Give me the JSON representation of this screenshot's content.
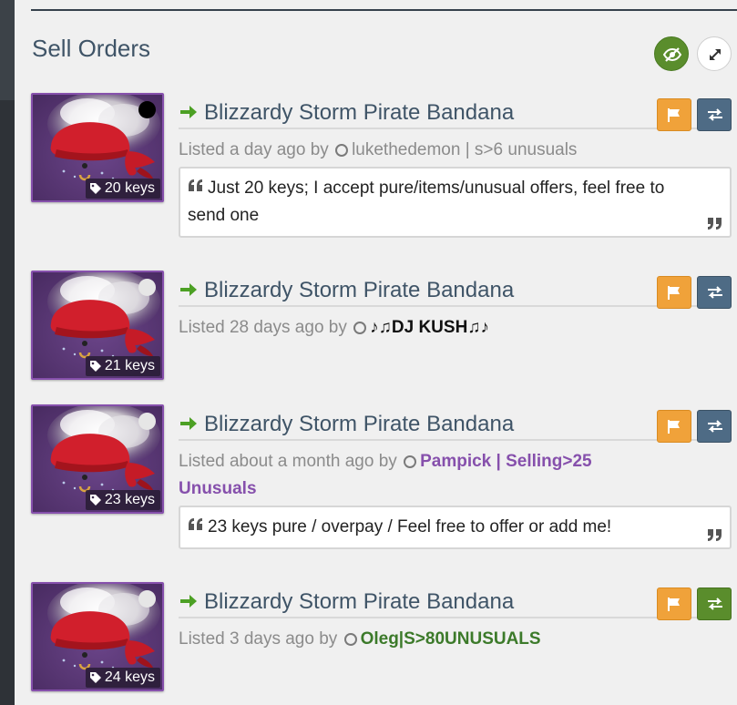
{
  "section": {
    "title": "Sell Orders",
    "eye_icon": "eye-slash-icon",
    "expand_icon": "expand-arrows-icon"
  },
  "colors": {
    "trade_blue": "#4e6b85",
    "trade_green": "#5a8d2c",
    "flag_orange": "#f0a23a",
    "unusual_purple": "#8650ac"
  },
  "listings": [
    {
      "item_name": "Blizzardy Storm Pirate Bandana",
      "price": "20 keys",
      "listed_prefix": "Listed a day ago by",
      "user": "lukethedemon | s>6 unusuals",
      "comment": "Just 20 keys; I accept pure/items/unusual offers, feel free to send one",
      "status_dot": "#000000"
    },
    {
      "item_name": "Blizzardy Storm Pirate Bandana",
      "price": "21 keys",
      "listed_prefix": "Listed 28 days ago by",
      "user": "♪♫DJ KUSH♫♪",
      "comment": "",
      "status_dot": "#e6e6e6"
    },
    {
      "item_name": "Blizzardy Storm Pirate Bandana",
      "price": "23 keys",
      "listed_prefix": "Listed about a month ago by",
      "user": "Pampick | Selling>25 Unusuals",
      "comment": "23 keys pure / overpay / Feel free to offer or add me!",
      "status_dot": "#e6e6e6"
    },
    {
      "item_name": "Blizzardy Storm Pirate Bandana",
      "price": "24 keys",
      "listed_prefix": "Listed 3 days ago by",
      "user": "Oleg|S>80UNUSUALS",
      "comment": "",
      "status_dot": "#e6e6e6"
    }
  ]
}
